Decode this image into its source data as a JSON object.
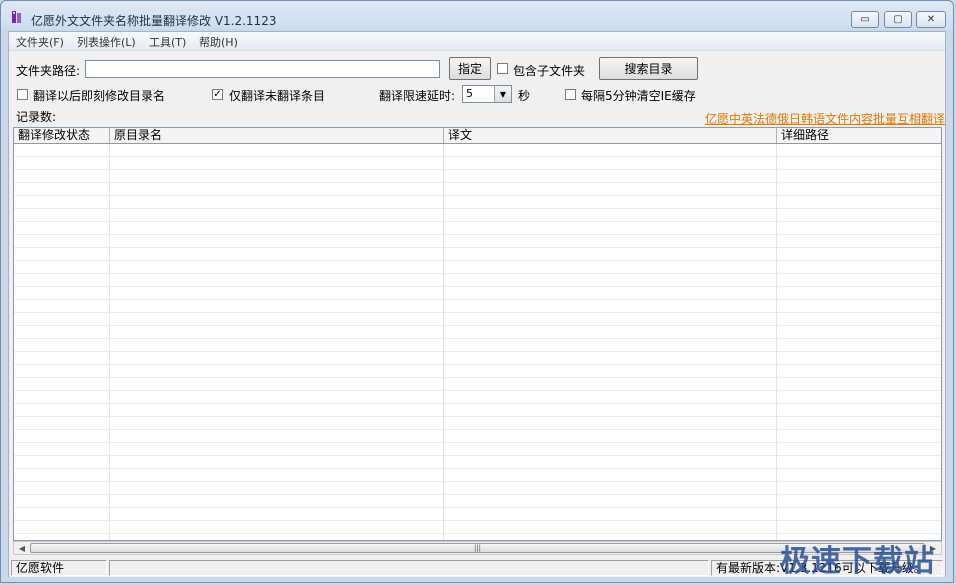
{
  "window": {
    "title": "亿愿外文文件夹名称批量翻译修改 V1.2.1123"
  },
  "menu": [
    "文件夹(F)",
    "列表操作(L)",
    "工具(T)",
    "帮助(H)"
  ],
  "toolbar": {
    "folder_label": "文件夹路径:",
    "folder_value": "",
    "specify_button": "指定",
    "include_sub_label": "包含子文件夹",
    "include_sub_checked": false,
    "search_button": "搜索目录"
  },
  "options": {
    "rename_after_label": "翻译以后即刻修改目录名",
    "rename_after_checked": false,
    "only_untranslated_label": "仅翻译未翻译条目",
    "only_untranslated_checked": true,
    "delay_label": "翻译限速延时:",
    "delay_value": "5",
    "delay_unit": "秒",
    "clear_cache_label": "每隔5分钟清空IE缓存",
    "clear_cache_checked": false
  },
  "records_label": "记录数:",
  "promo_link": "亿愿中英法德俄日韩语文件内容批量互相翻译",
  "table": {
    "columns": [
      "翻译修改状态",
      "原目录名",
      "译文",
      "详细路径"
    ],
    "rows": []
  },
  "status": {
    "company": "亿愿软件",
    "update": "有最新版本:V1.3.1216可以下载升级。"
  },
  "watermark": "极速下载站"
}
